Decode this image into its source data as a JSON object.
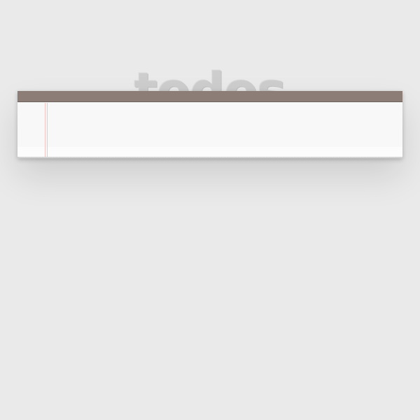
{
  "app": {
    "title": "todos"
  },
  "new_todo": {
    "value": "",
    "placeholder": ""
  },
  "colors": {
    "page_background": "#eaeaea",
    "title": "#cdcdcd",
    "header_bar": "#8d7d77",
    "panel": "#f9f9f9",
    "margin_line": "#f2c6c0"
  }
}
